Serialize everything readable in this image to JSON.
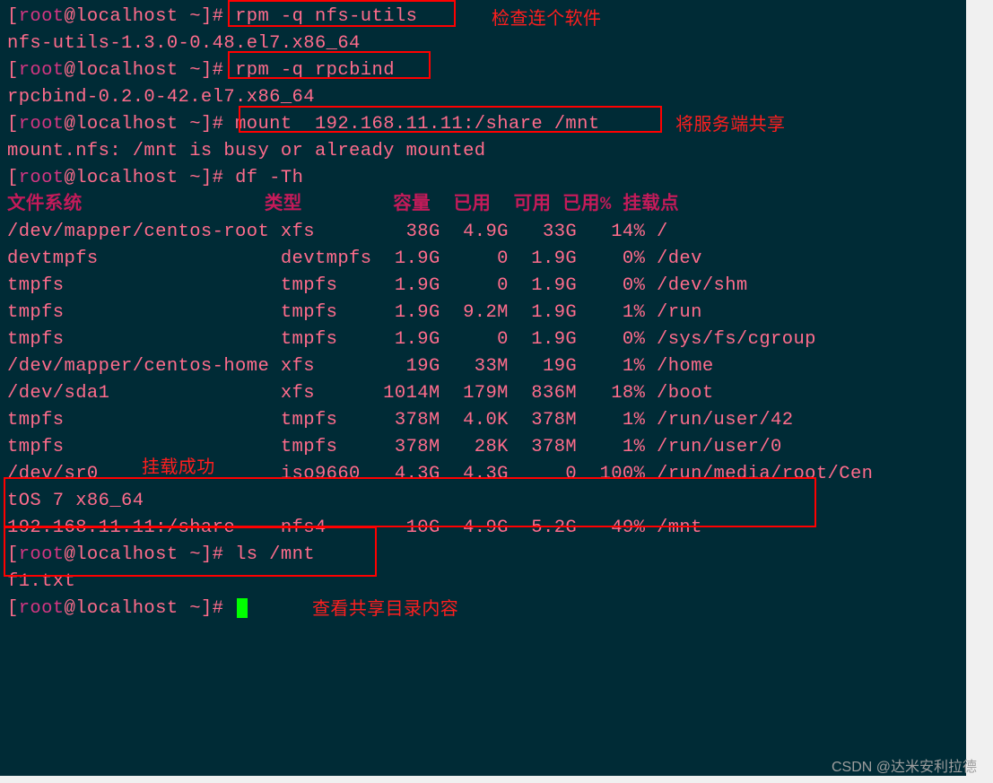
{
  "prompt": {
    "open": "[",
    "user": "root",
    "at": "@",
    "host": "localhost",
    "path": " ~",
    "close": "]# "
  },
  "commands": {
    "c1": "rpm -q nfs-utils",
    "o1": "nfs-utils-1.3.0-0.48.el7.x86_64",
    "c2": "rpm -q rpcbind",
    "o2": "rpcbind-0.2.0-42.el7.x86_64",
    "c3": "mount  192.168.11.11:/share /mnt",
    "o3": "mount.nfs: /mnt is busy or already mounted",
    "c4": "df -Th",
    "c5": "ls /mnt",
    "o5": "f1.txt"
  },
  "df": {
    "header": "文件系统                类型        容量  已用  可用 已用% 挂载点",
    "rows": [
      "/dev/mapper/centos-root xfs        38G  4.9G   33G   14% /",
      "devtmpfs                devtmpfs  1.9G     0  1.9G    0% /dev",
      "tmpfs                   tmpfs     1.9G     0  1.9G    0% /dev/shm",
      "tmpfs                   tmpfs     1.9G  9.2M  1.9G    1% /run",
      "tmpfs                   tmpfs     1.9G     0  1.9G    0% /sys/fs/cgroup",
      "/dev/mapper/centos-home xfs        19G   33M   19G    1% /home",
      "/dev/sda1               xfs      1014M  179M  836M   18% /boot",
      "tmpfs                   tmpfs     378M  4.0K  378M    1% /run/user/42",
      "tmpfs                   tmpfs     378M   28K  378M    1% /run/user/0",
      "/dev/sr0                iso9660   4.3G  4.3G     0  100% /run/media/root/Cen",
      "tOS 7 x86_64",
      "192.168.11.11:/share    nfs4       10G  4.9G  5.2G   49% /mnt"
    ]
  },
  "annotations": {
    "a1": "检查连个软件",
    "a2": "将服务端共享",
    "a3": "挂载成功",
    "a4": "查看共享目录内容"
  },
  "watermark": "CSDN @达米安利拉德"
}
